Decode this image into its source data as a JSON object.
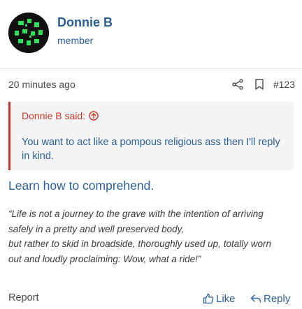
{
  "user": {
    "name": "Donnie B",
    "title": "member",
    "avatar_icon": "avatar-icon"
  },
  "meta": {
    "time": "20 minutes ago",
    "post_number": "#123",
    "share_icon": "share-icon",
    "bookmark_icon": "bookmark-icon"
  },
  "quote": {
    "author": "Donnie B said:",
    "text": "You want to act like a pompous religious ass then I'll reply in kind.",
    "arrow_icon": "arrow-up-circle-icon"
  },
  "reply": {
    "headline": "Learn how to comprehend.",
    "quotation": [
      "“Life is not a journey to the grave with the intention of arriving",
      "safely in a pretty and well preserved body,",
      "but rather to skid in broadside, thoroughly used up, totally worn",
      "out and loudly proclaiming: Wow, what a ride!”"
    ]
  },
  "footer": {
    "report_label": "Report",
    "like_label": "Like",
    "reply_label": "Reply",
    "like_icon": "thumbs-up-icon",
    "reply_icon": "reply-arrow-icon"
  },
  "colors": {
    "link_blue": "#2a5f97",
    "quote_red": "#c33a2b",
    "quote_bg": "#f5f5f5"
  }
}
